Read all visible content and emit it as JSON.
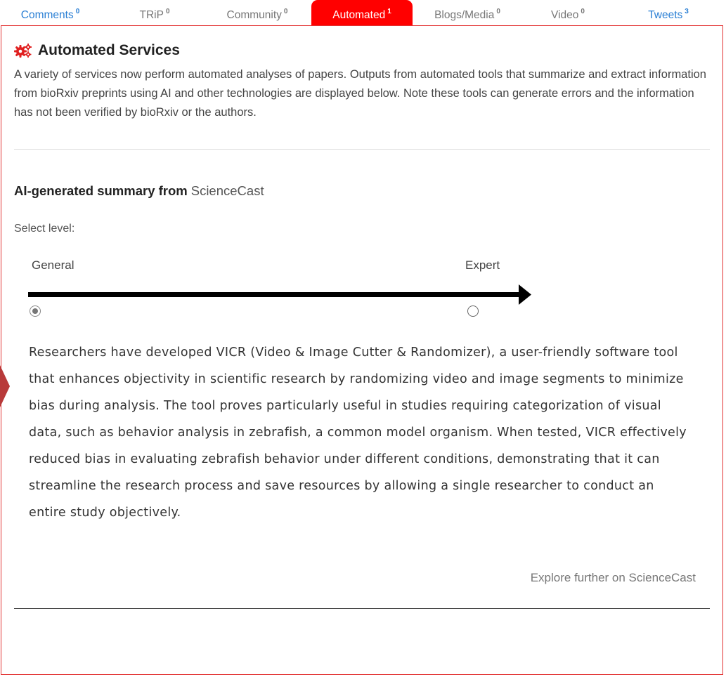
{
  "tabs": [
    {
      "label": "Comments",
      "count": "0",
      "active": false,
      "link": true
    },
    {
      "label": "TRiP",
      "count": "0",
      "active": false,
      "link": false
    },
    {
      "label": "Community",
      "count": "0",
      "active": false,
      "link": false
    },
    {
      "label": "Automated",
      "count": "1",
      "active": true,
      "link": false
    },
    {
      "label": "Blogs/Media",
      "count": "0",
      "active": false,
      "link": false
    },
    {
      "label": "Video",
      "count": "0",
      "active": false,
      "link": false
    },
    {
      "label": "Tweets",
      "count": "3",
      "active": false,
      "link": true
    }
  ],
  "panel": {
    "title": "Automated Services",
    "title_icon": "gears-icon",
    "intro": "A variety of services now perform automated analyses of papers. Outputs from automated tools that summarize and extract information from bioRxiv preprints using AI and other technologies are displayed below. Note these tools can generate errors and the information has not been verified by bioRxiv or the authors."
  },
  "summary": {
    "heading": "AI-generated summary from",
    "source": "ScienceCast",
    "select_label": "Select level:",
    "levels": [
      {
        "label": "General",
        "selected": true
      },
      {
        "label": "Expert",
        "selected": false
      }
    ],
    "text": "Researchers have developed VICR (Video & Image Cutter & Randomizer), a user-friendly software tool that enhances objectivity in scientific research by randomizing video and image segments to minimize bias during analysis. The tool proves particularly useful in studies requiring categorization of visual data, such as behavior analysis in zebrafish, a common model organism. When tested, VICR effectively reduced bias in evaluating zebrafish behavior under different conditions, demonstrating that it can streamline the research process and save resources by allowing a single researcher to conduct an entire study objectively.",
    "explore_link": "Explore further on ScienceCast"
  },
  "colors": {
    "accent": "#ff0000",
    "panel_border": "#e23232",
    "link": "#2a7fd4",
    "side_pointer": "#b83a3a"
  }
}
